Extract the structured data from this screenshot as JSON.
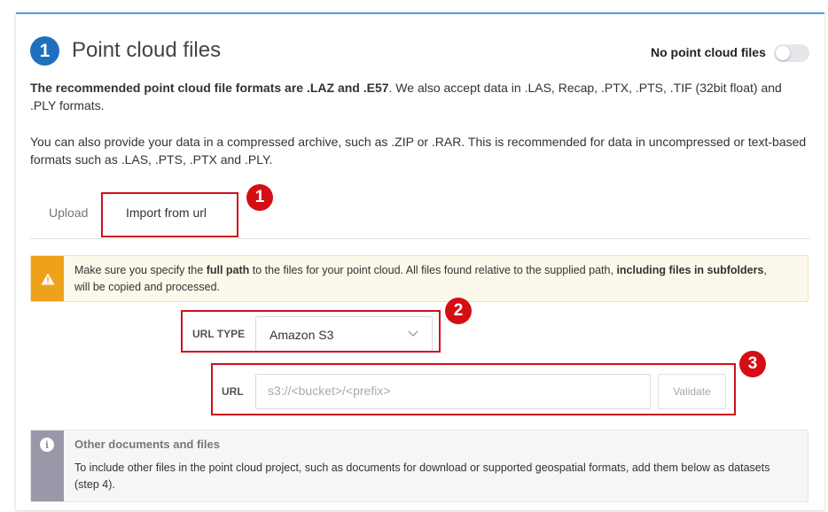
{
  "section": {
    "step_number": "1",
    "title": "Point cloud files",
    "toggle_label": "No point cloud files",
    "toggle_on": false
  },
  "description": {
    "formats_bold": "The recommended point cloud file formats are .LAZ and .E57",
    "formats_rest": ". We also accept data in .LAS, Recap, .PTX, .PTS, .TIF (32bit float) and .PLY formats.",
    "archive_note": "You can also provide your data in a compressed archive, such as .ZIP or .RAR. This is recommended for data in uncompressed or text-based formats such as .LAS, .PTS, .PTX and .PLY."
  },
  "tabs": [
    {
      "label": "Upload",
      "active": false
    },
    {
      "label": "Import from url",
      "active": true
    }
  ],
  "warning": {
    "icon": "warning-triangle-icon",
    "t1": "Make sure you specify the ",
    "b1": "full path",
    "t2": " to the files for your point cloud. All files found relative to the supplied path, ",
    "b2": "including files in subfolders",
    "t3": ", will be copied and processed."
  },
  "form": {
    "url_type_label": "URL TYPE",
    "url_type_value": "Amazon S3",
    "url_label": "URL",
    "url_placeholder": "s3://<bucket>/<prefix>",
    "url_value": "",
    "validate_label": "Validate"
  },
  "info": {
    "icon": "info-icon",
    "title": "Other documents and files",
    "text": "To include other files in the point cloud project, such as documents for download or supported geospatial formats, add them below as datasets (step 4)."
  },
  "annotations": [
    "1",
    "2",
    "3"
  ],
  "colors": {
    "primary": "#1f6fbf",
    "annotation_red": "#d40e14",
    "warning": "#eea21c",
    "info": "#9a98a8"
  }
}
